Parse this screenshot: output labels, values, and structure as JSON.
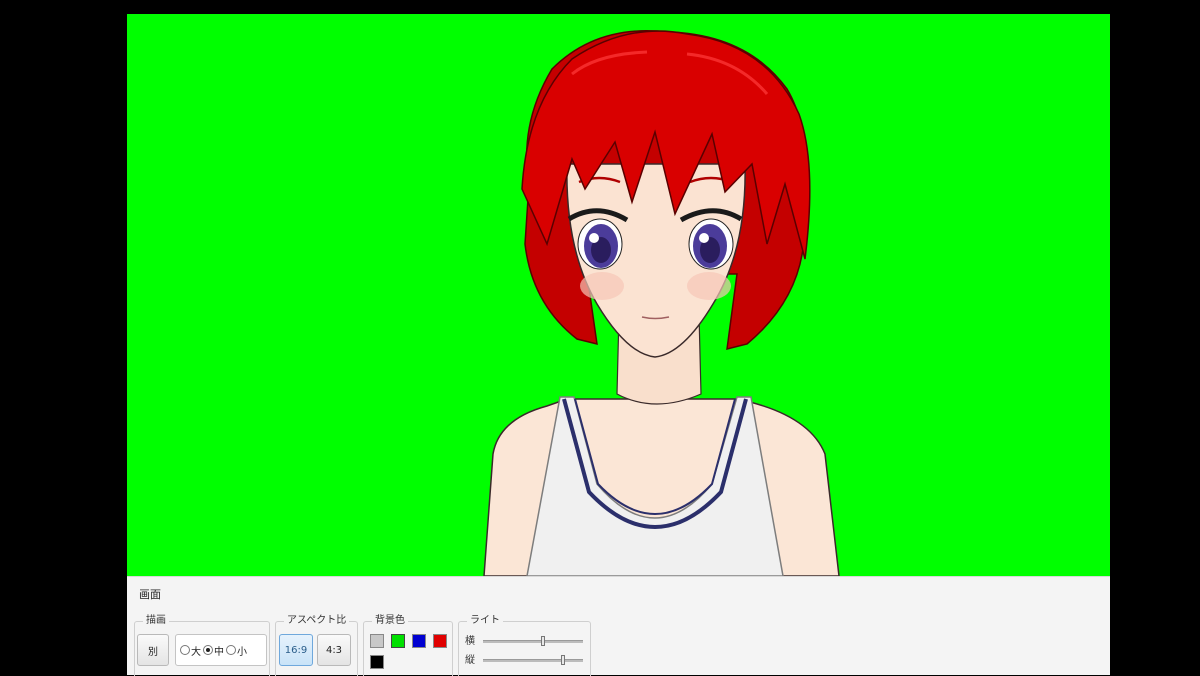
{
  "viewport": {
    "background_color": "#00ff00"
  },
  "panel": {
    "title": "画面",
    "render": {
      "label": "描画",
      "separate_button": "別",
      "size_options": [
        {
          "label": "大",
          "checked": false
        },
        {
          "label": "中",
          "checked": true
        },
        {
          "label": "小",
          "checked": false
        }
      ]
    },
    "aspect": {
      "label": "アスペクト比",
      "options": [
        {
          "label": "16:9",
          "selected": true
        },
        {
          "label": "4:3",
          "selected": false
        }
      ]
    },
    "background": {
      "label": "背景色",
      "swatches": [
        "#c8c8c8",
        "#00e000",
        "#0000d0",
        "#e00000",
        "#000000"
      ],
      "selected": "#00e000"
    },
    "light": {
      "label": "ライト",
      "horizontal_label": "横",
      "vertical_label": "縦",
      "horizontal_value": 0.6,
      "vertical_value": 0.8
    }
  }
}
